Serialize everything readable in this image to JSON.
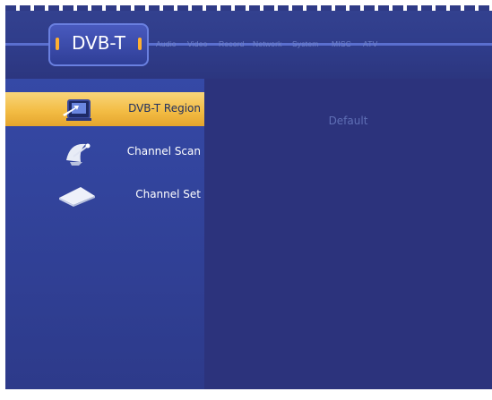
{
  "tabs": {
    "active": "DVB-T",
    "items": [
      "Audio",
      "Video",
      "Record",
      "Network",
      "System",
      "MISC",
      "ATV"
    ]
  },
  "menu": {
    "items": [
      {
        "label": "DVB-T Region",
        "icon": "antenna-tv-icon",
        "selected": true
      },
      {
        "label": "Channel Scan",
        "icon": "satellite-dish-icon",
        "selected": false
      },
      {
        "label": "Channel Set",
        "icon": "remote-control-icon",
        "selected": false
      }
    ]
  },
  "content": {
    "value": "Default"
  },
  "colors": {
    "background": "#2b3479",
    "highlight": "#f3bd45",
    "text": "#ffffff",
    "muted": "#5f6fb5"
  }
}
